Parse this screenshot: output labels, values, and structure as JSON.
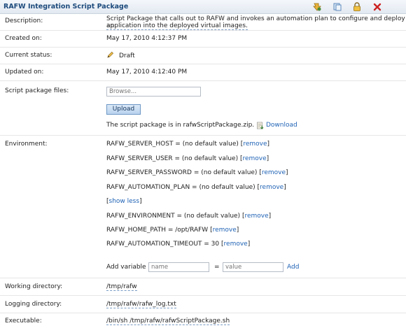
{
  "header": {
    "title": "RAFW Integration Script Package"
  },
  "toolbar": {
    "icons": [
      "clone-icon",
      "export-icon",
      "lock-icon",
      "delete-icon"
    ]
  },
  "description": {
    "label": "Description:",
    "line1": "Script Package that calls out to RAFW and invokes an automation plan to configure and deploy an",
    "line2": "application into the deployed virtual images."
  },
  "created": {
    "label": "Created on:",
    "value": "May 17, 2010 4:12:37 PM"
  },
  "status": {
    "label": "Current status:",
    "value": "Draft"
  },
  "updated": {
    "label": "Updated on:",
    "value": "May 17, 2010 4:12:40 PM"
  },
  "files": {
    "label": "Script package files:",
    "browse_placeholder": "Browse...",
    "upload_label": "Upload",
    "info": "The script package is in rafwScriptPackage.zip.",
    "download_label": "Download"
  },
  "environment": {
    "label": "Environment:",
    "remove_label": "remove",
    "show_less": "show less",
    "vars": [
      "RAFW_SERVER_HOST = (no default value)",
      "RAFW_SERVER_USER = (no default value)",
      "RAFW_SERVER_PASSWORD = (no default value)",
      "RAFW_AUTOMATION_PLAN = (no default value)",
      "RAFW_ENVIRONMENT = (no default value)",
      "RAFW_HOME_PATH = /opt/RAFW",
      "RAFW_AUTOMATION_TIMEOUT = 30"
    ],
    "add_variable_label": "Add variable",
    "name_placeholder": "name",
    "equals": "=",
    "value_placeholder": "value",
    "add_label": "Add"
  },
  "working_dir": {
    "label": "Working directory:",
    "value": "/tmp/rafw"
  },
  "logging_dir": {
    "label": "Logging directory:",
    "value": "/tmp/rafw/rafw_log.txt"
  },
  "executable": {
    "label": "Executable:",
    "value": "/bin/sh /tmp/rafw/rafwScriptPackage.sh"
  },
  "colors": {
    "accent": "#1f62b5",
    "title": "#1d4a7c",
    "delete": "#cc2222"
  }
}
